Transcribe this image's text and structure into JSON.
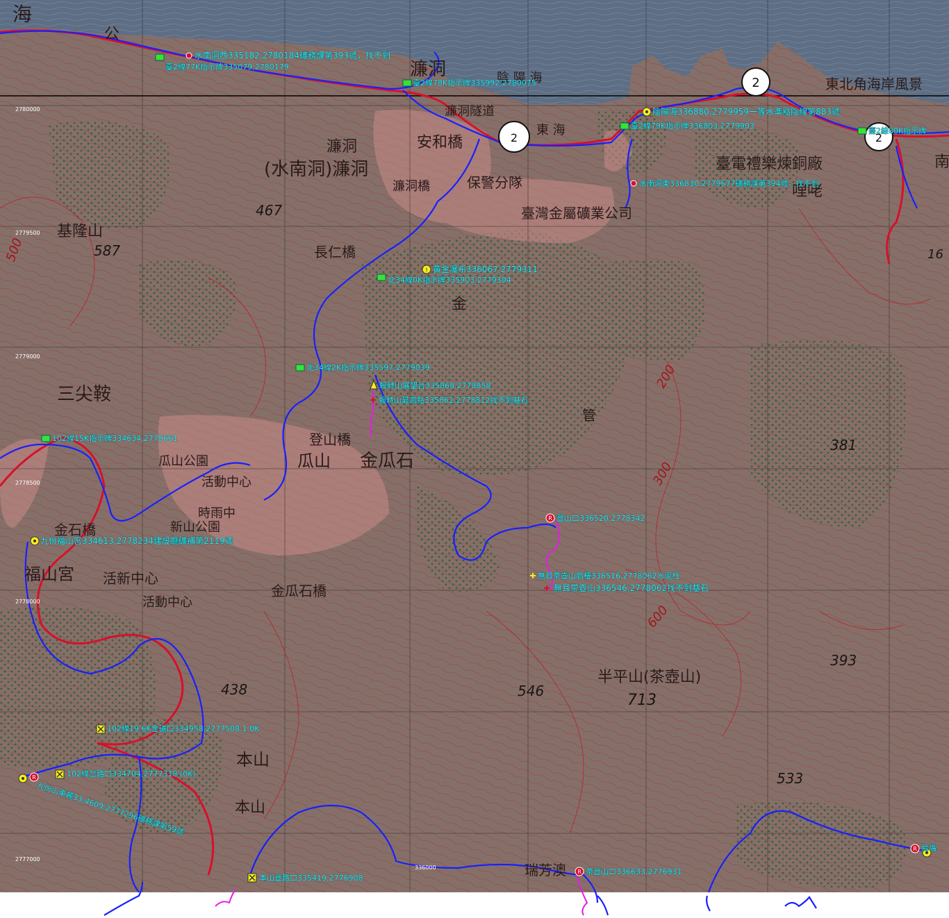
{
  "map_labels": {
    "sea_top": "海",
    "road_top": "公",
    "lianDong": "濂洞",
    "yinyang_sea": "陰  陽  海",
    "east_sea": "東 海",
    "east_coast": "東北角海岸風景",
    "lianDong_tunnel": "濂洞隧道",
    "lianDong_village": "濂洞",
    "anhe_bridge": "安和橋",
    "lianDong_shuinan": "(水南洞)濂洞",
    "lianDong_bridge": "濂洞橋",
    "police": "保警分隊",
    "taipower": "臺電禮樂煉銅廠",
    "taiwan_metal": "臺灣金屬礦業公司",
    "liyao": "哩咾",
    "keelung_mtn": "基隆山",
    "changren_bridge": "長仁橋",
    "jin": "金",
    "sanjian": "三尖鞍",
    "jinguashi": "金瓜石",
    "denghan_bridge": "登山橋",
    "guashan": "瓜山",
    "guashan_park": "瓜山公園",
    "activity_center": "活動中心",
    "shinan": "時雨中",
    "xinshan_park": "新山公園",
    "jinshi_bridge": "金石橋",
    "fushan_temple": "福山宮",
    "chuxin_center": "活新中心",
    "activity_center2": "活動中心",
    "jingua_bridge": "金瓜石橋",
    "banping": "半平山(茶壺山)",
    "benshan": "本山",
    "benshan2": "本山",
    "rui_river": "瑞芳澳",
    "guan": "管",
    "nan": "南"
  },
  "route_numbers": {
    "taiwan2_a": "2",
    "taiwan2_b": "2",
    "taiwan2_c": "2",
    "taiwan2_d": "2"
  },
  "elevations": {
    "e467": "467",
    "e587": "587",
    "e438": "438",
    "e546": "546",
    "e713": "713",
    "e381": "381",
    "e393": "393",
    "e533": "533",
    "e16": "16"
  },
  "contour_labels": {
    "c500": "500",
    "c200": "200",
    "c300": "300",
    "c600": "600"
  },
  "waypoints": [
    "水南洞西335182,2780184礦務課第393號，找不到",
    "臺2線77K指示牌335079,2780179",
    "臺2線78K指示牌335992,2780075",
    "陰陽海336880,2779959一等水準點陰線第883號",
    "臺2線79K指示牌336803,2779903",
    "臺2線80K指示牌",
    "水南洞東336830,2779677礦務課第394號，找不到",
    "黃金瀑布336067,2779311",
    "北34線0K指示牌335903,2779304",
    "北34線2K指示牌335597,2779039",
    "報時山展望台335868,2778858",
    "報時山最高點335862,2778812找不到基石",
    "102線15K指示牌334634,2778661",
    "登山口336520,2778342",
    "九份福山宮334613,2778234建設廳礦補第2119號",
    "無耳茶壺山肩樓336516,2778062水泥柱",
    "無耳茶壺山336546,2778062找不到基石",
    "102線19.6K金礦口334958,2777508 1.0K",
    "102線岔路口334704,2777318 (0K)",
    "九份山東麓33,4609,2777296礦務課第59號",
    "本山登路口335419,2776908",
    "茶登山口336633,2776931",
    "鳥嘴"
  ],
  "grid_ticks": {
    "t1": "2780000",
    "t2": "2779500",
    "t3": "2779000",
    "t4": "2778500",
    "t5": "2778000",
    "t6": "2777000",
    "t7": "336000"
  },
  "colors": {
    "sea": "#5e6f85",
    "terrain": "#866e6b",
    "contour": "#b8202a",
    "road_red": "#d8102b",
    "road_blue": "#1820ff",
    "track_magenta": "#e61ce6",
    "label_cyan": "#1ef0ff",
    "vegetation": "#2e5a33"
  }
}
